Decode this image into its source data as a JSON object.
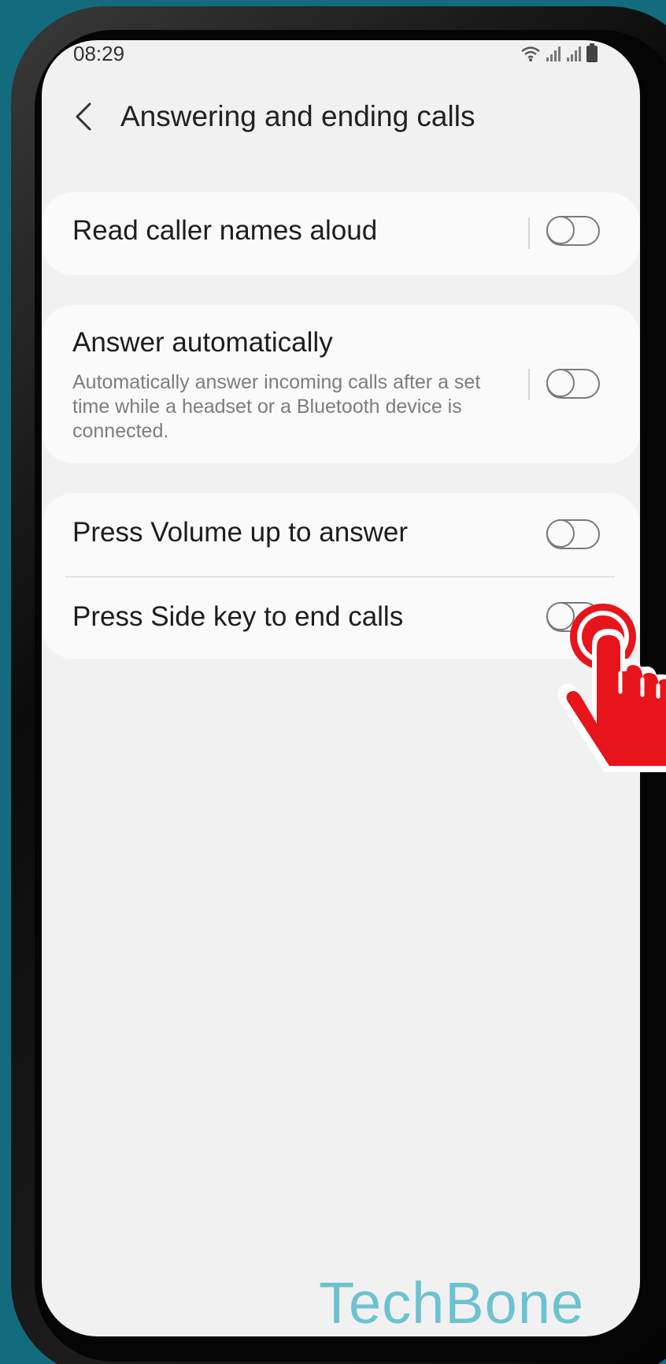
{
  "status_bar": {
    "time": "08:29",
    "icons": [
      "wifi-icon",
      "signal-icon",
      "signal-icon",
      "battery-icon"
    ]
  },
  "header": {
    "back_icon": "chevron-left-icon",
    "title": "Answering and ending calls"
  },
  "settings": {
    "read_caller_names": {
      "title": "Read caller names aloud",
      "enabled": false
    },
    "answer_automatically": {
      "title": "Answer automatically",
      "description": "Automatically answer incoming calls after a set time while a headset or a Bluetooth device is connected.",
      "enabled": false
    },
    "volume_up_answer": {
      "title": "Press Volume up to answer",
      "enabled": false
    },
    "side_key_end": {
      "title": "Press Side key to end calls",
      "enabled": false
    }
  },
  "overlay": {
    "pointer_icon": "tap-hand-icon",
    "pointer_color": "#e8141b",
    "watermark": "TechBone",
    "watermark_color": "#6cc3cf"
  }
}
